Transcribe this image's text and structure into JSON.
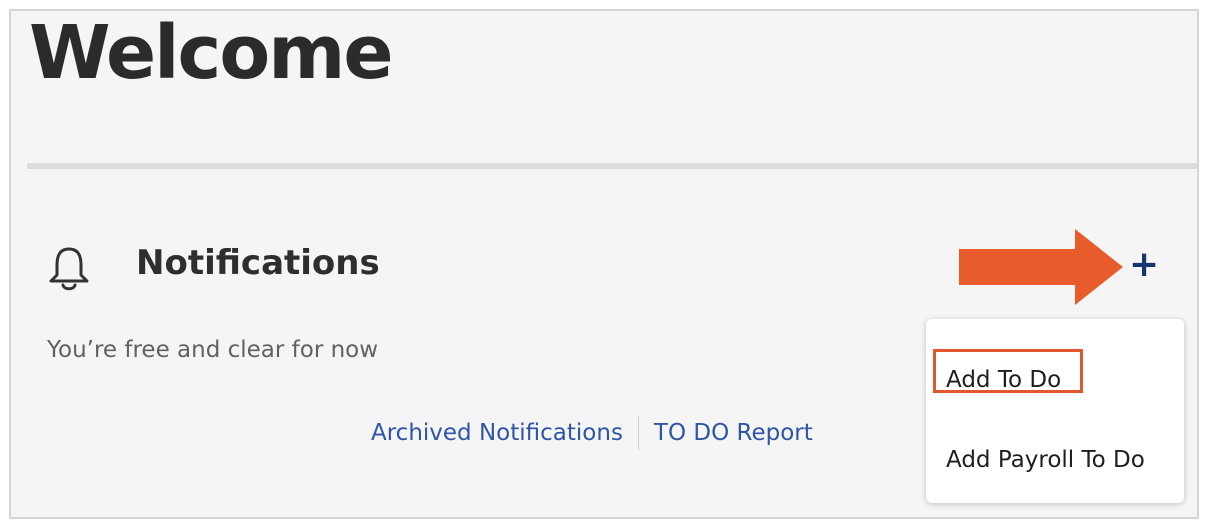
{
  "page": {
    "title": "Welcome"
  },
  "notifications": {
    "title": "Notifications",
    "icon": "bell-icon",
    "add_icon": "plus-icon",
    "empty_message": "You’re free and clear for now",
    "links": {
      "archived": "Archived Notifications",
      "todo_report": "TO DO Report"
    }
  },
  "add_menu": {
    "items": [
      {
        "label": "Add To Do",
        "highlighted": true
      },
      {
        "label": "Add Payroll To Do",
        "highlighted": false
      }
    ]
  },
  "colors": {
    "background": "#f5f5f5",
    "link": "#2e55a8",
    "plus": "#17356e",
    "annotation": "#e4572e"
  }
}
